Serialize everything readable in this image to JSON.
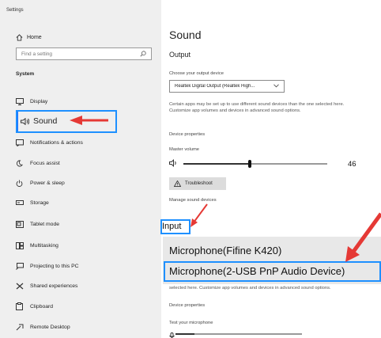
{
  "window": {
    "title": "Settings"
  },
  "sidebar": {
    "home": {
      "label": "Home",
      "icon": "home-icon"
    },
    "search": {
      "placeholder": "Find a setting",
      "icon": "search-icon"
    },
    "section": "System",
    "items": [
      {
        "label": "Display",
        "icon": "display-icon"
      },
      {
        "label": "Sound",
        "icon": "speaker-icon",
        "selected": true
      },
      {
        "label": "Notifications & actions",
        "icon": "notifications-icon"
      },
      {
        "label": "Focus assist",
        "icon": "moon-icon"
      },
      {
        "label": "Power & sleep",
        "icon": "power-icon"
      },
      {
        "label": "Storage",
        "icon": "storage-icon"
      },
      {
        "label": "Tablet mode",
        "icon": "tablet-icon"
      },
      {
        "label": "Multitasking",
        "icon": "multitasking-icon"
      },
      {
        "label": "Projecting to this PC",
        "icon": "projecting-icon"
      },
      {
        "label": "Shared experiences",
        "icon": "shared-icon"
      },
      {
        "label": "Clipboard",
        "icon": "clipboard-icon"
      },
      {
        "label": "Remote Desktop",
        "icon": "remote-desktop-icon"
      }
    ]
  },
  "main": {
    "title": "Sound",
    "output": {
      "heading": "Output",
      "device_label": "Choose your output device",
      "device_value": "Realtek Digital Output (Realtek High...",
      "description": "Certain apps may be set up to use different sound devices than the one selected here. Customize app volumes and devices in advanced sound options.",
      "device_properties": "Device properties",
      "master_volume_label": "Master volume",
      "volume": 46,
      "troubleshoot": "Troubleshoot",
      "manage_devices": "Manage sound devices"
    },
    "input": {
      "heading": "Input",
      "options": [
        "Microphone(Fifine K420)",
        "Microphone(2-USB PnP Audio Device)"
      ],
      "selected": "Microphone(2-USB PnP Audio Device)",
      "description": "selected here. Customize app volumes and devices in advanced sound options.",
      "device_properties": "Device properties",
      "test_label": "Test your microphone",
      "test_level": 0.15
    }
  },
  "colors": {
    "highlight": "#1e90ff",
    "arrow": "#e53935",
    "sidebar_bg": "#efefef"
  }
}
